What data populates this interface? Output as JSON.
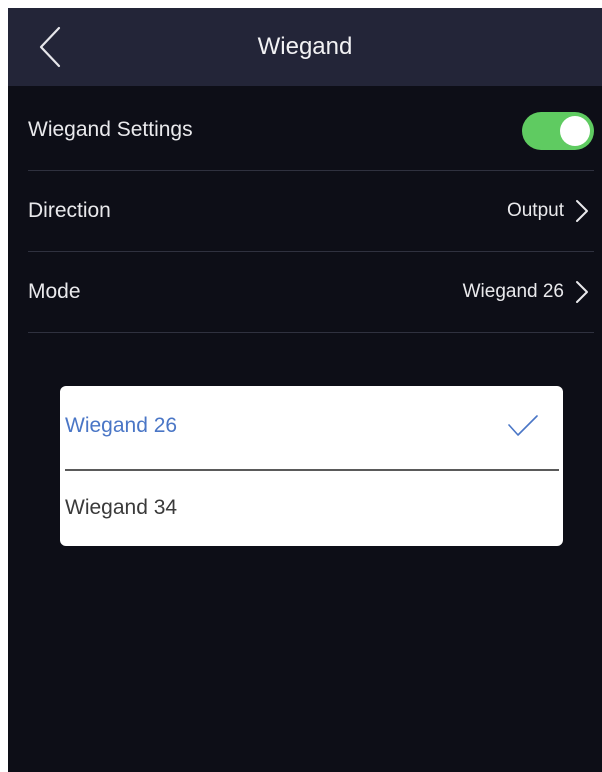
{
  "header": {
    "title": "Wiegand",
    "back_icon": "chevron-left-icon"
  },
  "settings": {
    "wiegand_settings": {
      "label": "Wiegand Settings",
      "enabled": true,
      "toggle_color": "#5fcb61"
    },
    "direction": {
      "label": "Direction",
      "value": "Output"
    },
    "mode": {
      "label": "Mode",
      "value": "Wiegand 26"
    }
  },
  "mode_picker": {
    "options": [
      {
        "label": "Wiegand 26",
        "selected": true
      },
      {
        "label": "Wiegand 34",
        "selected": false
      }
    ],
    "selected_color": "#4a76c6",
    "check_icon": "check-icon"
  }
}
